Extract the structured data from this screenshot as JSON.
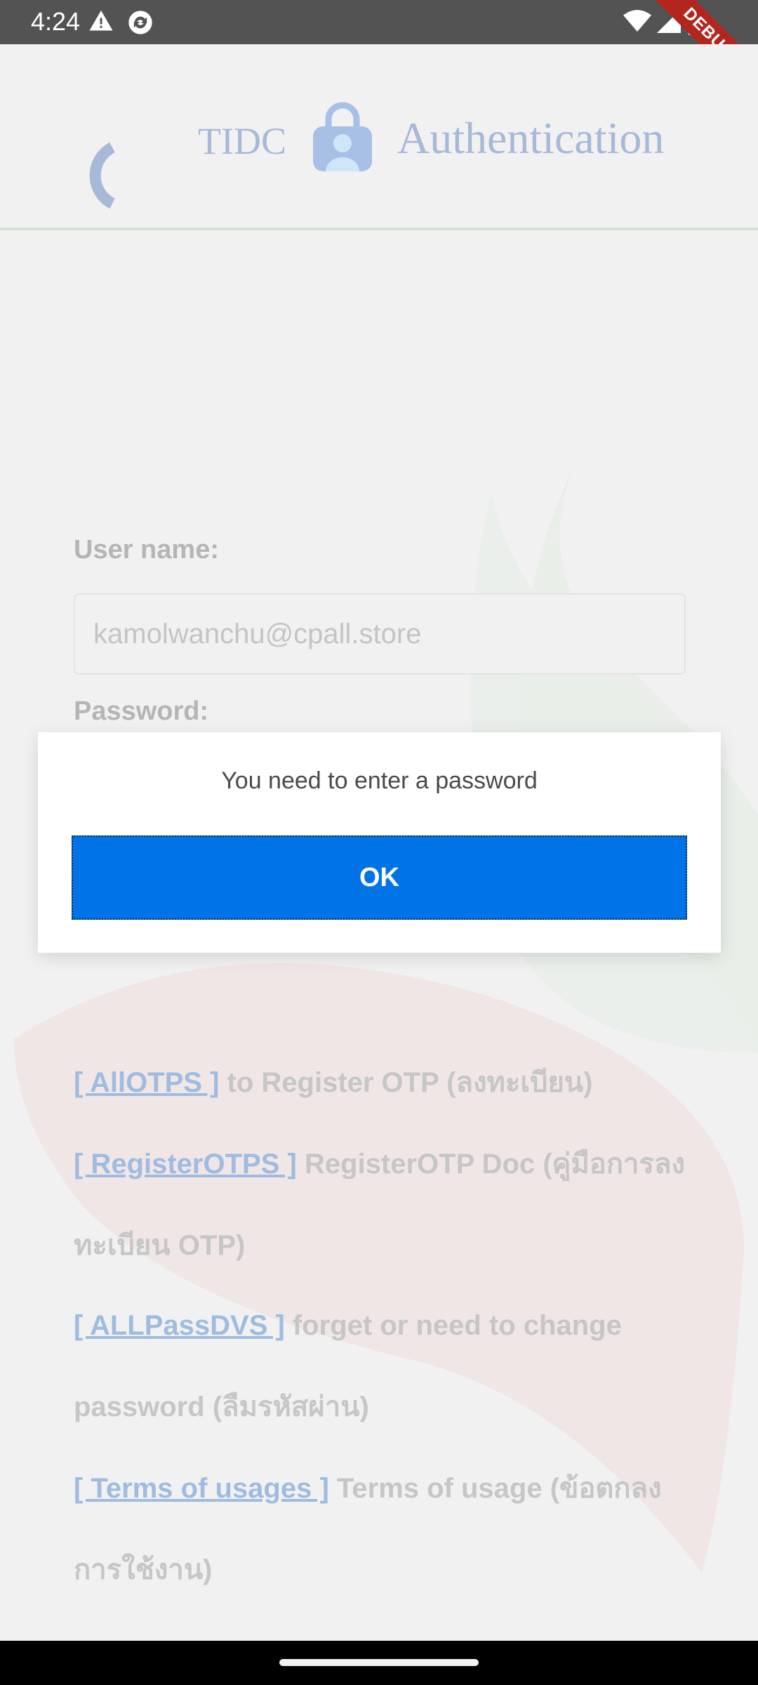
{
  "status_bar": {
    "time": "4:24"
  },
  "debug_banner": "DEBUG",
  "header": {
    "logo_left": "TIDC",
    "logo_right": "Authentication"
  },
  "form": {
    "username_label": "User name:",
    "username_value": "kamolwanchu@cpall.store",
    "password_label": "Password:"
  },
  "links": [
    {
      "link_text": "[ AllOTPS ]",
      "description": " to Register OTP (ลงทะเบียน)"
    },
    {
      "link_text": "[ RegisterOTPS ]",
      "description": " RegisterOTP Doc (คู่มือการลงทะเบียน OTP)"
    },
    {
      "link_text": "[ ALLPassDVS ]",
      "description": " forget or need to change password (ลืมรหัสผ่าน)"
    },
    {
      "link_text": "[ Terms of usages ]",
      "description": " Terms of usage (ข้อตกลงการใช้งาน)"
    }
  ],
  "dialog": {
    "message": "You need to enter a password",
    "ok_label": "OK"
  },
  "colors": {
    "accent": "#0073e6",
    "debug_banner": "#b3261e",
    "link": "#9fbce0"
  }
}
